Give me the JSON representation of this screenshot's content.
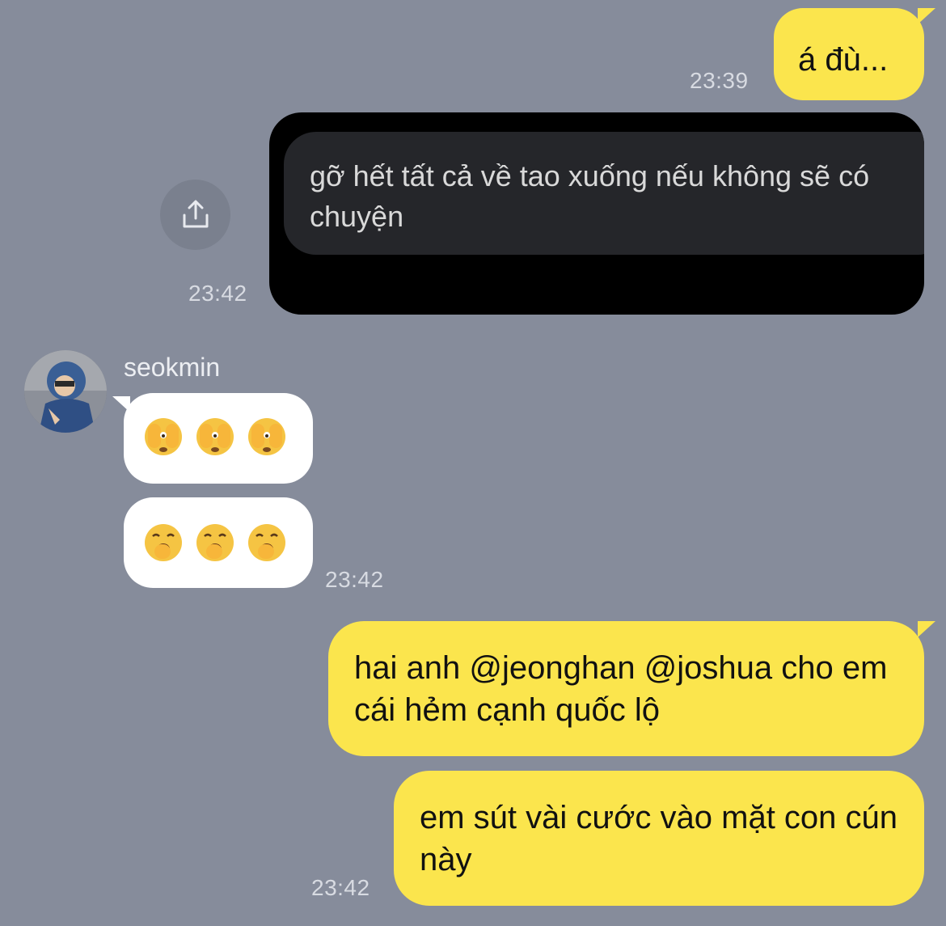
{
  "messages": [
    {
      "id": "m1",
      "side": "right",
      "text": "á đù...",
      "time": "23:39"
    },
    {
      "id": "m2",
      "side": "right",
      "type": "image",
      "image_text": "gỡ hết tất cả về tao xuống nếu không sẽ có chuyện",
      "time": "23:42"
    },
    {
      "id": "m3",
      "side": "left",
      "sender": "seokmin",
      "emojis": [
        "🫣",
        "🫣",
        "🫣"
      ]
    },
    {
      "id": "m4",
      "side": "left",
      "emojis": [
        "🥱",
        "🥱",
        "🥱"
      ],
      "time": "23:42"
    },
    {
      "id": "m5",
      "side": "right",
      "text": "hai anh @jeonghan @joshua cho em cái hẻm cạnh quốc lộ"
    },
    {
      "id": "m6",
      "side": "right",
      "text": "em sút vài cước vào mặt con cún này",
      "time": "23:42"
    }
  ],
  "icons": {
    "share": "share-icon",
    "avatar": "avatar"
  },
  "colors": {
    "background": "#868c9b",
    "outgoing_bubble": "#fbe54d",
    "incoming_bubble": "#ffffff",
    "timestamp": "#d8dbe2"
  }
}
